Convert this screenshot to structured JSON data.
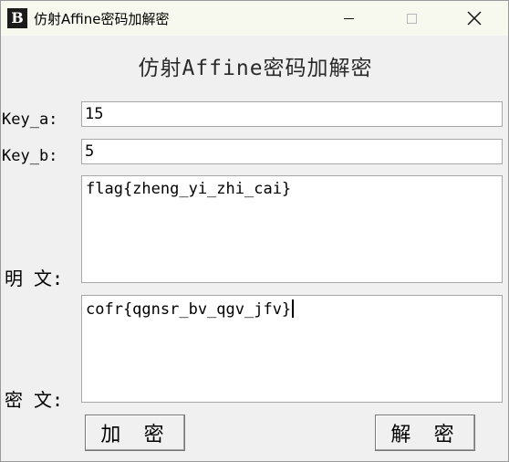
{
  "window": {
    "title": "仿射Affine密码加解密",
    "icon_letter": "B"
  },
  "heading": "仿射Affine密码加解密",
  "fields": {
    "key_a": {
      "label": "Key_a:",
      "value": "15"
    },
    "key_b": {
      "label": "Key_b:",
      "value": "5"
    }
  },
  "plaintext": {
    "label": "明 文:",
    "value": "flag{zheng_yi_zhi_cai}"
  },
  "ciphertext": {
    "label": "密 文:",
    "value": "cofr{qgnsr_bv_qgv_jfv}"
  },
  "buttons": {
    "encrypt": "加 密",
    "decrypt": "解 密"
  },
  "colors": {
    "titlebar": "#f7f9ee",
    "window_bg": "#f0f0f0"
  }
}
